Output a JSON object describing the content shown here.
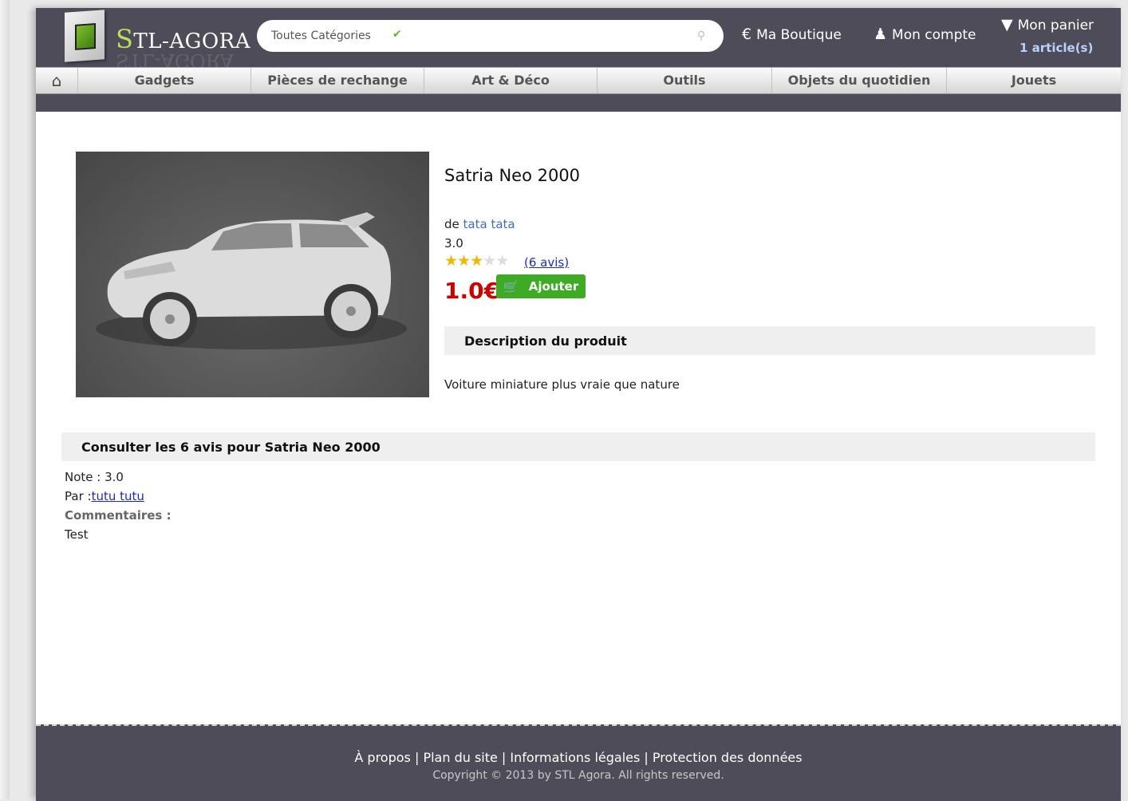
{
  "header": {
    "logo_first_letter": "S",
    "logo_rest": "TL-AGORA",
    "search": {
      "category": "Toutes Catégories",
      "placeholder": ""
    },
    "nav": {
      "boutique": "Ma Boutique",
      "compte": "Mon compte",
      "panier": "Mon panier",
      "cart_count": "1 article(s)"
    }
  },
  "categories": [
    "Gadgets",
    "Pièces de rechange",
    "Art & Déco",
    "Outils",
    "Objets du quotidien",
    "Jouets"
  ],
  "product": {
    "title": "Satria Neo 2000",
    "by_prefix": "de",
    "author": "tata tata",
    "rating": "3.0",
    "stars_filled": 3,
    "stars_total": 5,
    "reviews_link": "(6 avis)",
    "price": "1.0€",
    "add_button": "Ajouter",
    "desc_header": "Description du produit",
    "description": "Voiture miniature plus vraie que nature"
  },
  "reviews": {
    "header": "Consulter les 6 avis pour Satria Neo 2000",
    "items": [
      {
        "note_label": "Note :",
        "note": "3.0",
        "by_label": "Par :",
        "author": "tutu tutu",
        "comments_label": "Commentaires :",
        "comment": "Test"
      }
    ]
  },
  "footer": {
    "links": [
      "À propos",
      "Plan du site",
      "Informations légales",
      "Protection des données"
    ],
    "copyright": "Copyright © 2013 by STL Agora. All rights reserved."
  },
  "colors": {
    "header_bg": "#4d4c58",
    "price": "#d10000",
    "add_button": "#3dab24",
    "link": "#1b2ad0",
    "logo_accent": "#b9e05a"
  }
}
